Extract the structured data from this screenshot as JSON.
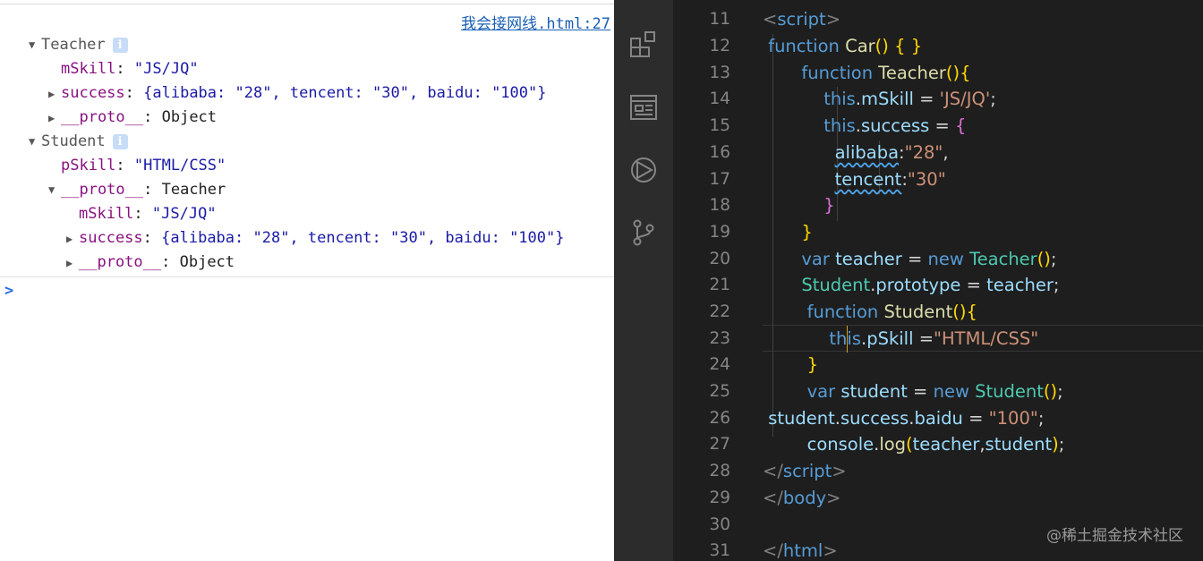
{
  "console": {
    "source_link": "我会接网线.html:27",
    "teacher_label": "Teacher",
    "teacher": {
      "mSkill_key": "mSkill",
      "mSkill_val": "\"JS/JQ\"",
      "success_key": "success",
      "success_val": "{alibaba: \"28\", tencent: \"30\", baidu: \"100\"}",
      "proto_key": "__proto__",
      "proto_val": "Object"
    },
    "student_label": "Student",
    "student": {
      "pSkill_key": "pSkill",
      "pSkill_val": "\"HTML/CSS\"",
      "proto_key": "__proto__",
      "proto_val": "Teacher",
      "inner_mSkill_key": "mSkill",
      "inner_mSkill_val": "\"JS/JQ\"",
      "inner_success_key": "success",
      "inner_success_val": "{alibaba: \"28\", tencent: \"30\", baidu: \"100\"}",
      "inner_proto_key": "__proto__",
      "inner_proto_val": "Object"
    },
    "info_glyph": "i",
    "prompt": ">"
  },
  "activity_icons": [
    "extensions-icon",
    "browser-preview-icon",
    "run-debug-icon",
    "source-control-icon"
  ],
  "editor": {
    "lines": [
      {
        "n": "11"
      },
      {
        "n": "12"
      },
      {
        "n": "13"
      },
      {
        "n": "14"
      },
      {
        "n": "15"
      },
      {
        "n": "16"
      },
      {
        "n": "17"
      },
      {
        "n": "18"
      },
      {
        "n": "19"
      },
      {
        "n": "20"
      },
      {
        "n": "21"
      },
      {
        "n": "22"
      },
      {
        "n": "23"
      },
      {
        "n": "24"
      },
      {
        "n": "25"
      },
      {
        "n": "26"
      },
      {
        "n": "27"
      },
      {
        "n": "28"
      },
      {
        "n": "29"
      },
      {
        "n": "30"
      },
      {
        "n": "31"
      }
    ],
    "watermark": "@稀土掘金技术社区"
  },
  "colors": {
    "editor_bg": "#1e1e1e",
    "activity_bg": "#2c2c2c",
    "keyword": "#569cd6",
    "function": "#dcdcaa",
    "class": "#4ec9b0",
    "property": "#9cdcfe",
    "string": "#ce9178",
    "console_key": "#881280",
    "console_string": "#1a1aa6"
  }
}
